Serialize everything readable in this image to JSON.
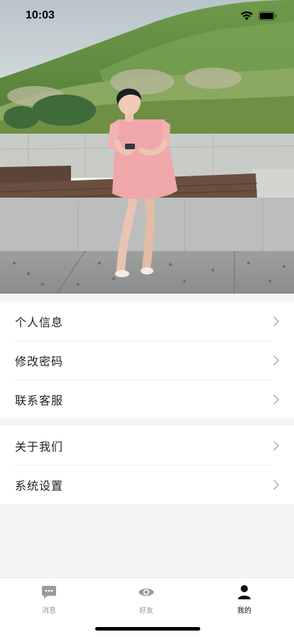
{
  "status_bar": {
    "time": "10:03",
    "icons": [
      "wifi-icon",
      "battery-icon"
    ]
  },
  "hero": {
    "description_icon": "profile-cover-photo"
  },
  "menu": {
    "group1": [
      {
        "label": "个人信息",
        "icon": "chevron-right-icon"
      },
      {
        "label": "修改密码",
        "icon": "chevron-right-icon"
      },
      {
        "label": "联系客服",
        "icon": "chevron-right-icon"
      }
    ],
    "group2": [
      {
        "label": "关于我们",
        "icon": "chevron-right-icon"
      },
      {
        "label": "系统设置",
        "icon": "chevron-right-icon"
      }
    ]
  },
  "tab_bar": {
    "tabs": [
      {
        "label": "消息",
        "icon": "message-icon",
        "active": false
      },
      {
        "label": "好友",
        "icon": "eye-icon",
        "active": false
      },
      {
        "label": "我的",
        "icon": "person-icon",
        "active": true
      }
    ]
  },
  "colors": {
    "background": "#f4f4f4",
    "card": "#ffffff",
    "text": "#222222",
    "tab_inactive": "#9a9a9a",
    "tab_active": "#111111"
  }
}
